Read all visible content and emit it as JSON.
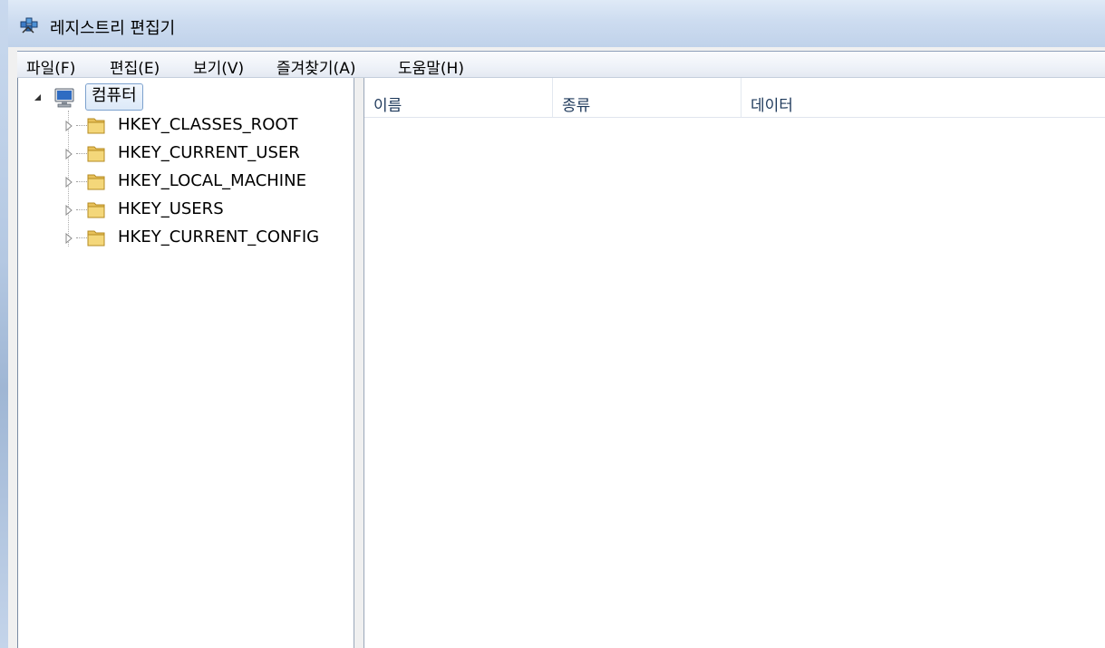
{
  "window": {
    "title": "레지스트리 편집기"
  },
  "menu": [
    "파일(F)",
    "편집(E)",
    "보기(V)",
    "즐겨찾기(A)",
    "도움말(H)"
  ],
  "tree": {
    "root": "컴퓨터",
    "items": [
      "HKEY_CLASSES_ROOT",
      "HKEY_CURRENT_USER",
      "HKEY_LOCAL_MACHINE",
      "HKEY_USERS",
      "HKEY_CURRENT_CONFIG"
    ]
  },
  "columns": [
    "이름",
    "종류",
    "데이터"
  ],
  "colors": {
    "titlebar": "#cddcf0",
    "header_text": "#1e395b",
    "selection_border": "#7da2ce",
    "folder": "#e8c15a"
  },
  "icons": {
    "app": "registry-icon",
    "root": "computer-icon",
    "item": "folder-icon"
  }
}
